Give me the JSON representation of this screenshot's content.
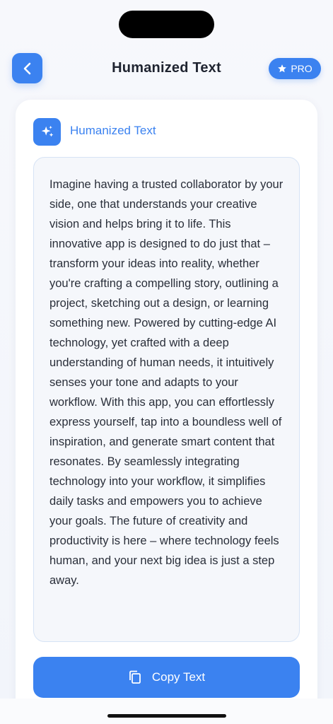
{
  "header": {
    "title": "Humanized Text",
    "back_icon": "chevron-left-icon",
    "pro_label": "PRO",
    "pro_icon": "star-icon"
  },
  "card": {
    "header_icon": "sparkles-icon",
    "header_label": "Humanized Text",
    "body": "Imagine having a trusted collaborator by your side, one that understands your creative vision and helps bring it to life. This innovative app is designed to do just that – transform your ideas into reality, whether you're crafting a compelling story, outlining a project, sketching out a design, or learning something new. Powered by cutting-edge AI technology, yet crafted with a deep understanding of human needs, it intuitively senses your tone and adapts to your workflow. With this app, you can effortlessly express yourself, tap into a boundless well of inspiration, and generate smart content that resonates. By seamlessly integrating technology into your workflow, it simplifies daily tasks and empowers you to achieve your goals. The future of creativity and productivity is here – where technology feels human, and your next big idea is just a step away."
  },
  "actions": {
    "copy_label": "Copy Text",
    "copy_icon": "copy-icon"
  },
  "colors": {
    "accent": "#3b82f0",
    "title_text": "#1f2430",
    "body_text": "#2a2f3a",
    "background": "#f4f6fb"
  }
}
